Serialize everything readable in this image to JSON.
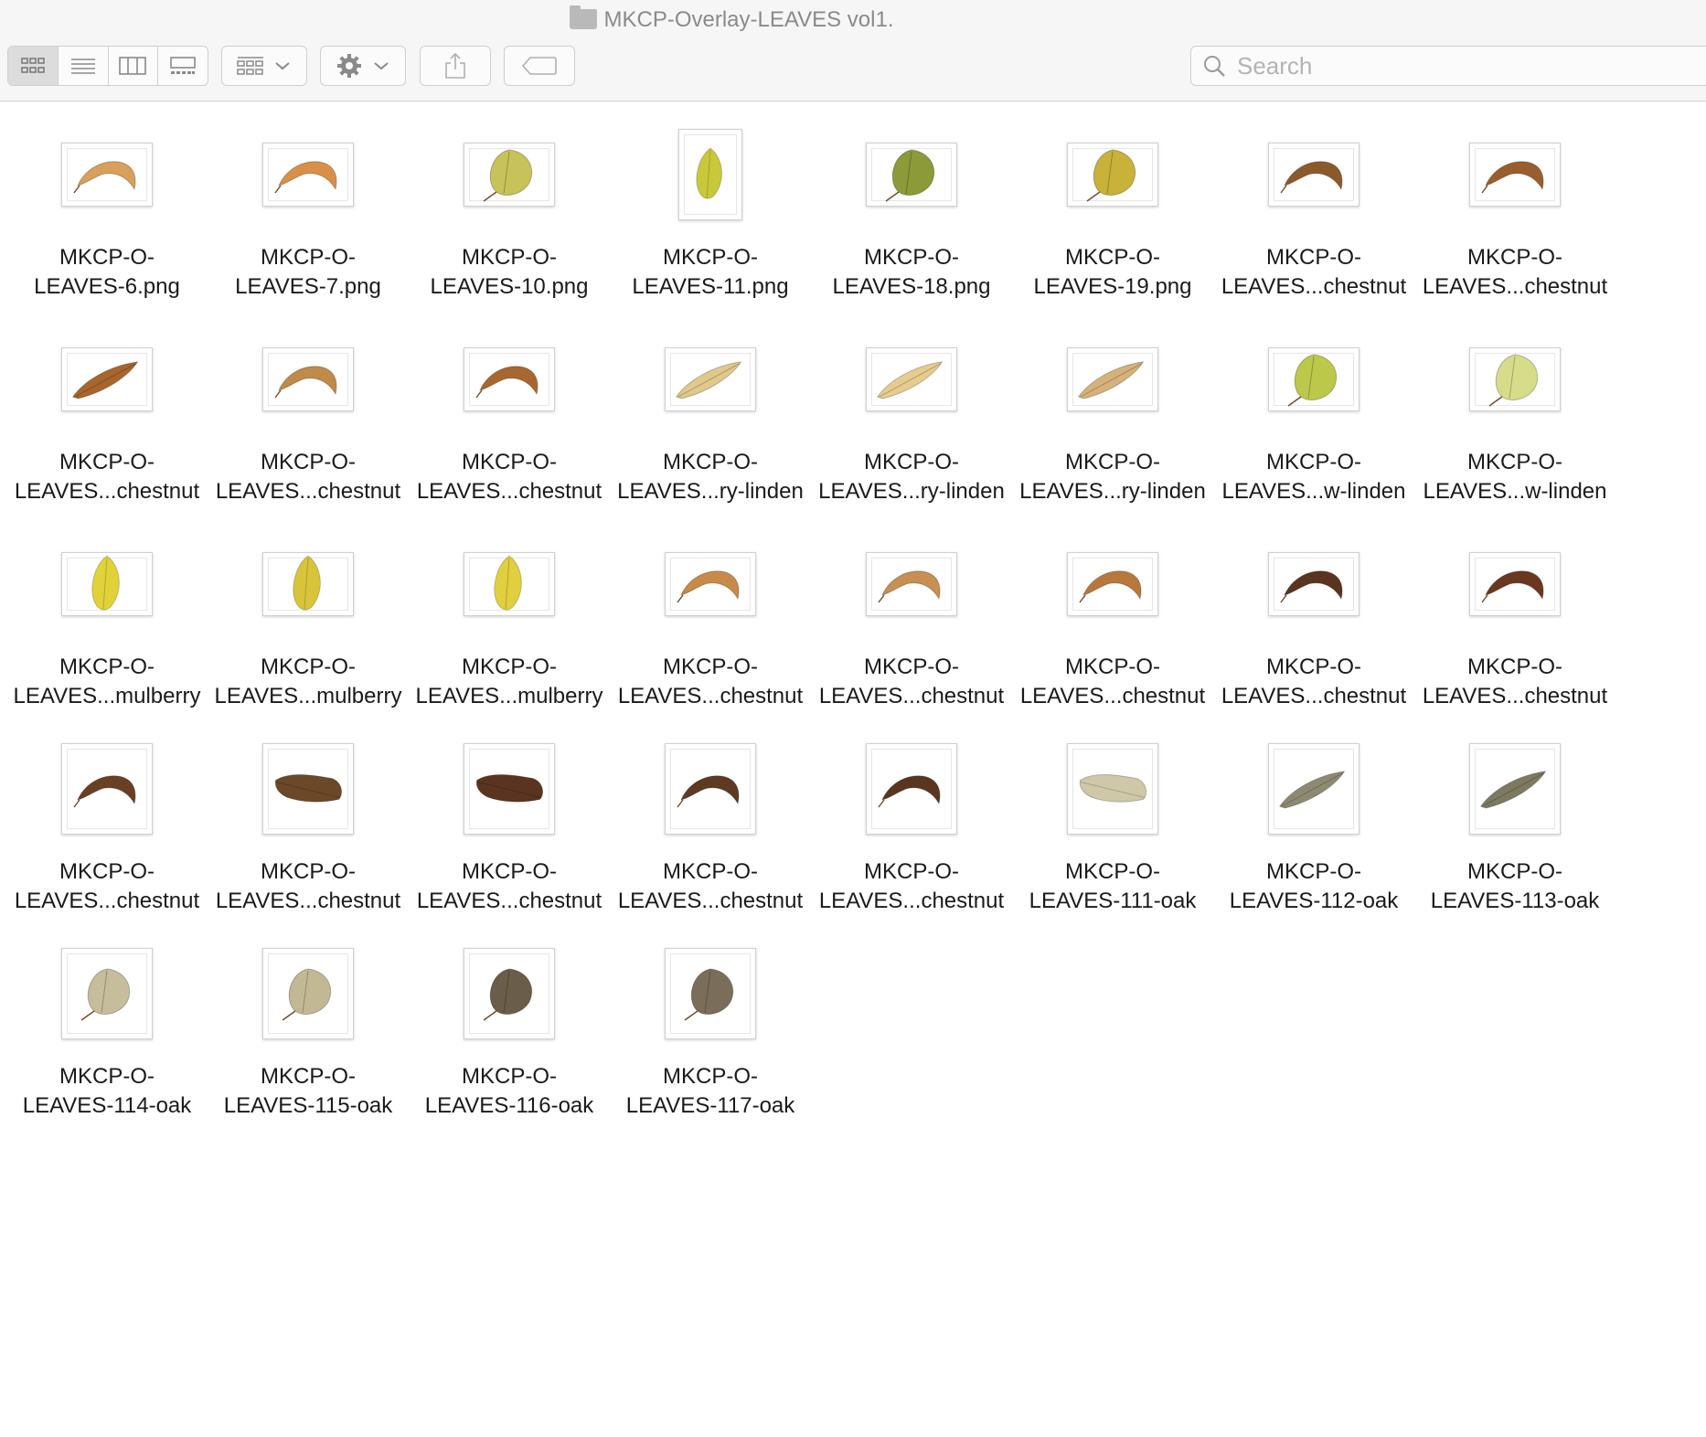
{
  "window": {
    "title": "MKCP-Overlay-LEAVES vol1."
  },
  "toolbar": {
    "view_buttons": [
      "icon-view-icon",
      "list-view-icon",
      "column-view-icon",
      "gallery-view-icon"
    ],
    "group_button": "group-by-icon",
    "action_button": "gear-icon",
    "share_button": "share-icon",
    "tag_button": "tag-icon",
    "search": {
      "placeholder": "Search",
      "value": ""
    }
  },
  "files": [
    {
      "l1": "MKCP-O-",
      "l2": "LEAVES-6.png",
      "leaf": "curl",
      "color": "#d8a05a",
      "shape": "wide"
    },
    {
      "l1": "MKCP-O-",
      "l2": "LEAVES-7.png",
      "leaf": "curl",
      "color": "#d89048",
      "shape": "wide"
    },
    {
      "l1": "MKCP-O-",
      "l2": "LEAVES-10.png",
      "leaf": "round",
      "color": "#c8c25a",
      "shape": "wide"
    },
    {
      "l1": "MKCP-O-",
      "l2": "LEAVES-11.png",
      "leaf": "oval",
      "color": "#c9c83a",
      "shape": "tall"
    },
    {
      "l1": "MKCP-O-",
      "l2": "LEAVES-18.png",
      "leaf": "round",
      "color": "#8c9a3a",
      "shape": "wide"
    },
    {
      "l1": "MKCP-O-",
      "l2": "LEAVES-19.png",
      "leaf": "round",
      "color": "#c8b23a",
      "shape": "wide"
    },
    {
      "l1": "MKCP-O-",
      "l2": "LEAVES...chestnut",
      "leaf": "curl",
      "color": "#8c5a2a",
      "shape": "wide"
    },
    {
      "l1": "MKCP-O-",
      "l2": "LEAVES...chestnut",
      "leaf": "curl",
      "color": "#9a5e2e",
      "shape": "wide"
    },
    {
      "l1": "MKCP-O-",
      "l2": "LEAVES...chestnut",
      "leaf": "long",
      "color": "#a8652c",
      "shape": "wide"
    },
    {
      "l1": "MKCP-O-",
      "l2": "LEAVES...chestnut",
      "leaf": "curl",
      "color": "#c08a48",
      "shape": "wide"
    },
    {
      "l1": "MKCP-O-",
      "l2": "LEAVES...chestnut",
      "leaf": "curl",
      "color": "#a8672f",
      "shape": "wide"
    },
    {
      "l1": "MKCP-O-",
      "l2": "LEAVES...ry-linden",
      "leaf": "long",
      "color": "#e0c98a",
      "shape": "wide"
    },
    {
      "l1": "MKCP-O-",
      "l2": "LEAVES...ry-linden",
      "leaf": "long",
      "color": "#e6cc8e",
      "shape": "wide"
    },
    {
      "l1": "MKCP-O-",
      "l2": "LEAVES...ry-linden",
      "leaf": "long",
      "color": "#d6b27a",
      "shape": "wide"
    },
    {
      "l1": "MKCP-O-",
      "l2": "LEAVES...w-linden",
      "leaf": "round",
      "color": "#bcc84a",
      "shape": "wide"
    },
    {
      "l1": "MKCP-O-",
      "l2": "LEAVES...w-linden",
      "leaf": "round",
      "color": "#d6dc8a",
      "shape": "wide"
    },
    {
      "l1": "MKCP-O-",
      "l2": "LEAVES...mulberry",
      "leaf": "oval",
      "color": "#e0d238",
      "shape": "wide"
    },
    {
      "l1": "MKCP-O-",
      "l2": "LEAVES...mulberry",
      "leaf": "oval",
      "color": "#d8c43a",
      "shape": "wide"
    },
    {
      "l1": "MKCP-O-",
      "l2": "LEAVES...mulberry",
      "leaf": "oval",
      "color": "#e0cf3e",
      "shape": "wide"
    },
    {
      "l1": "MKCP-O-",
      "l2": "LEAVES...chestnut",
      "leaf": "curl",
      "color": "#c88a48",
      "shape": "wide"
    },
    {
      "l1": "MKCP-O-",
      "l2": "LEAVES...chestnut",
      "leaf": "curl",
      "color": "#c88e52",
      "shape": "wide"
    },
    {
      "l1": "MKCP-O-",
      "l2": "LEAVES...chestnut",
      "leaf": "curl",
      "color": "#b8783c",
      "shape": "wide"
    },
    {
      "l1": "MKCP-O-",
      "l2": "LEAVES...chestnut",
      "leaf": "curl",
      "color": "#5a3420",
      "shape": "wide"
    },
    {
      "l1": "MKCP-O-",
      "l2": "LEAVES...chestnut",
      "leaf": "curl",
      "color": "#6a3820",
      "shape": "wide"
    },
    {
      "l1": "MKCP-O-",
      "l2": "LEAVES...chestnut",
      "leaf": "curl",
      "color": "#6a4024",
      "shape": "square"
    },
    {
      "l1": "MKCP-O-",
      "l2": "LEAVES...chestnut",
      "leaf": "wide",
      "color": "#6a4828",
      "shape": "square"
    },
    {
      "l1": "MKCP-O-",
      "l2": "LEAVES...chestnut",
      "leaf": "wide",
      "color": "#5a3420",
      "shape": "square"
    },
    {
      "l1": "MKCP-O-",
      "l2": "LEAVES...chestnut",
      "leaf": "curl",
      "color": "#5e3a22",
      "shape": "square"
    },
    {
      "l1": "MKCP-O-",
      "l2": "LEAVES...chestnut",
      "leaf": "curl",
      "color": "#5a3620",
      "shape": "square"
    },
    {
      "l1": "MKCP-O-",
      "l2": "LEAVES-111-oak",
      "leaf": "wide",
      "color": "#cfc8a8",
      "shape": "square"
    },
    {
      "l1": "MKCP-O-",
      "l2": "LEAVES-112-oak",
      "leaf": "long",
      "color": "#8e8a72",
      "shape": "square"
    },
    {
      "l1": "MKCP-O-",
      "l2": "LEAVES-113-oak",
      "leaf": "long",
      "color": "#7e7a62",
      "shape": "square"
    },
    {
      "l1": "MKCP-O-",
      "l2": "LEAVES-114-oak",
      "leaf": "round",
      "color": "#c6bd9c",
      "shape": "square"
    },
    {
      "l1": "MKCP-O-",
      "l2": "LEAVES-115-oak",
      "leaf": "round",
      "color": "#c2b894",
      "shape": "square"
    },
    {
      "l1": "MKCP-O-",
      "l2": "LEAVES-116-oak",
      "leaf": "round",
      "color": "#6a5e4a",
      "shape": "square"
    },
    {
      "l1": "MKCP-O-",
      "l2": "LEAVES-117-oak",
      "leaf": "round",
      "color": "#7a6e5a",
      "shape": "square"
    }
  ]
}
